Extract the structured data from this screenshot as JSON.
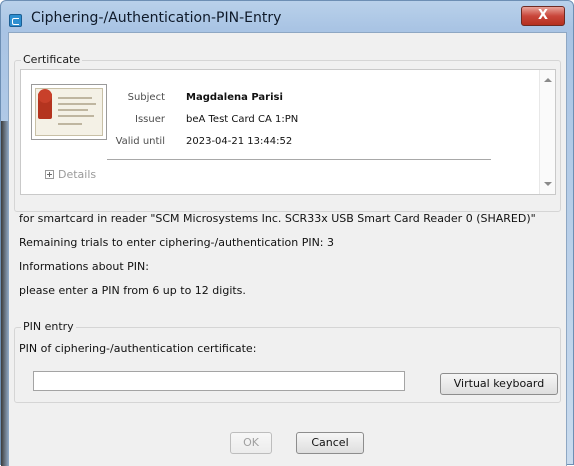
{
  "window": {
    "title": "Ciphering-/Authentication-PIN-Entry",
    "close_label": "X"
  },
  "certificate": {
    "legend": "Certificate",
    "subject_label": "Subject",
    "subject_value": "Magdalena Parisi",
    "issuer_label": "Issuer",
    "issuer_value": "beA Test Card CA 1:PN",
    "valid_label": "Valid until",
    "valid_value": "2023-04-21 13:44:52",
    "details_label": "Details"
  },
  "info": {
    "reader": "for smartcard in reader \"SCM Microsystems Inc. SCR33x USB Smart Card Reader 0 (SHARED)\"",
    "remaining": "Remaining trials to enter ciphering-/authentication PIN: 3",
    "about": "Informations about PIN:",
    "hint": "please enter a PIN from 6 up to 12 digits."
  },
  "pin_entry": {
    "legend": "PIN entry",
    "field_label": "PIN of ciphering-/authentication certificate:",
    "value": "",
    "virtual_keyboard_label": "Virtual keyboard"
  },
  "buttons": {
    "ok_label": "OK",
    "cancel_label": "Cancel"
  }
}
